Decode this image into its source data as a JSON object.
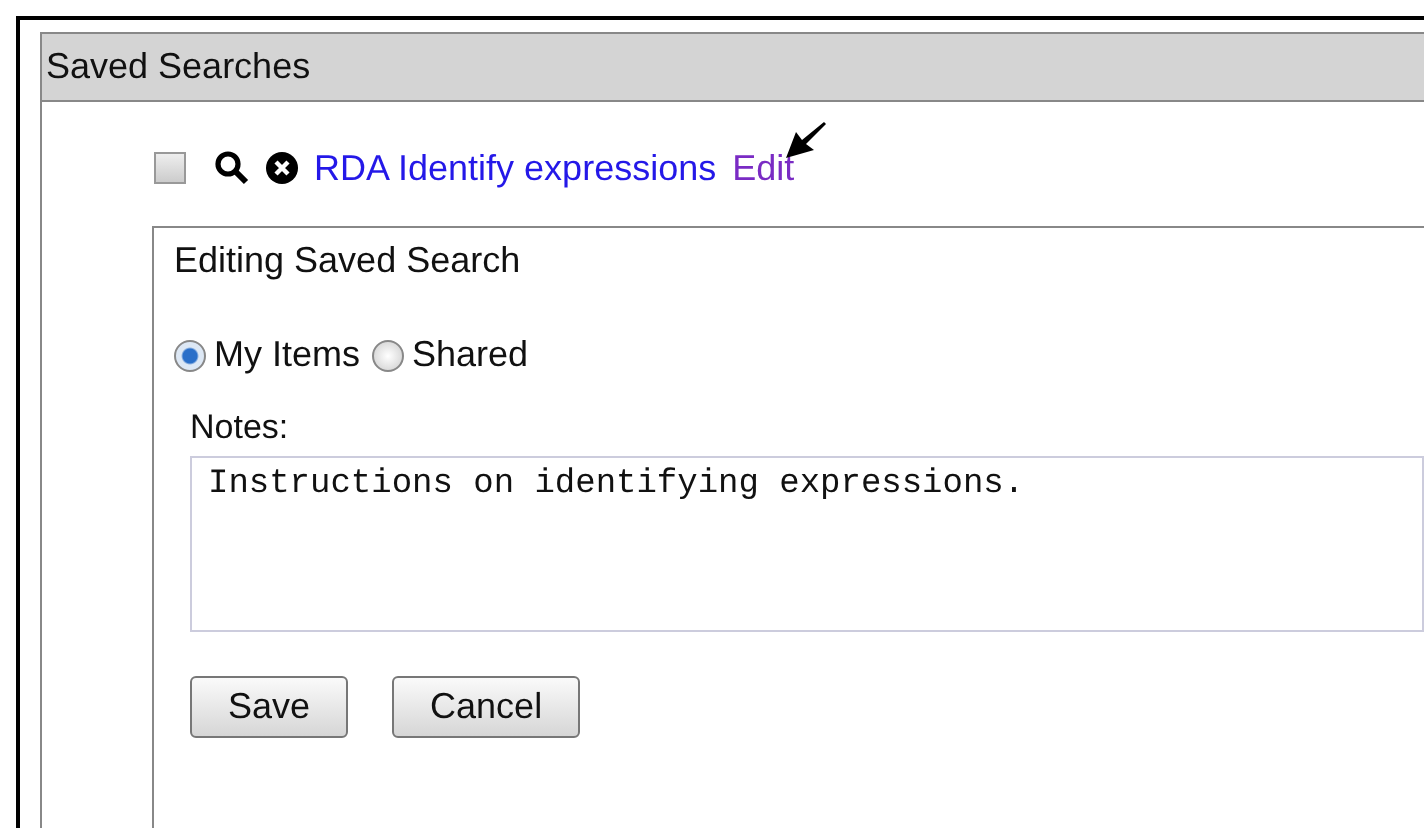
{
  "panel": {
    "title": "Saved Searches"
  },
  "saved_search": {
    "checked": false,
    "name": "RDA Identify expressions",
    "edit_link": "Edit"
  },
  "editor": {
    "title": "Editing Saved Search",
    "scope": [
      {
        "label": "My Items",
        "selected": true
      },
      {
        "label": "Shared",
        "selected": false
      }
    ],
    "notes_label": "Notes:",
    "notes_value": "Instructions on identifying expressions.",
    "buttons": [
      "Save",
      "Cancel"
    ]
  }
}
